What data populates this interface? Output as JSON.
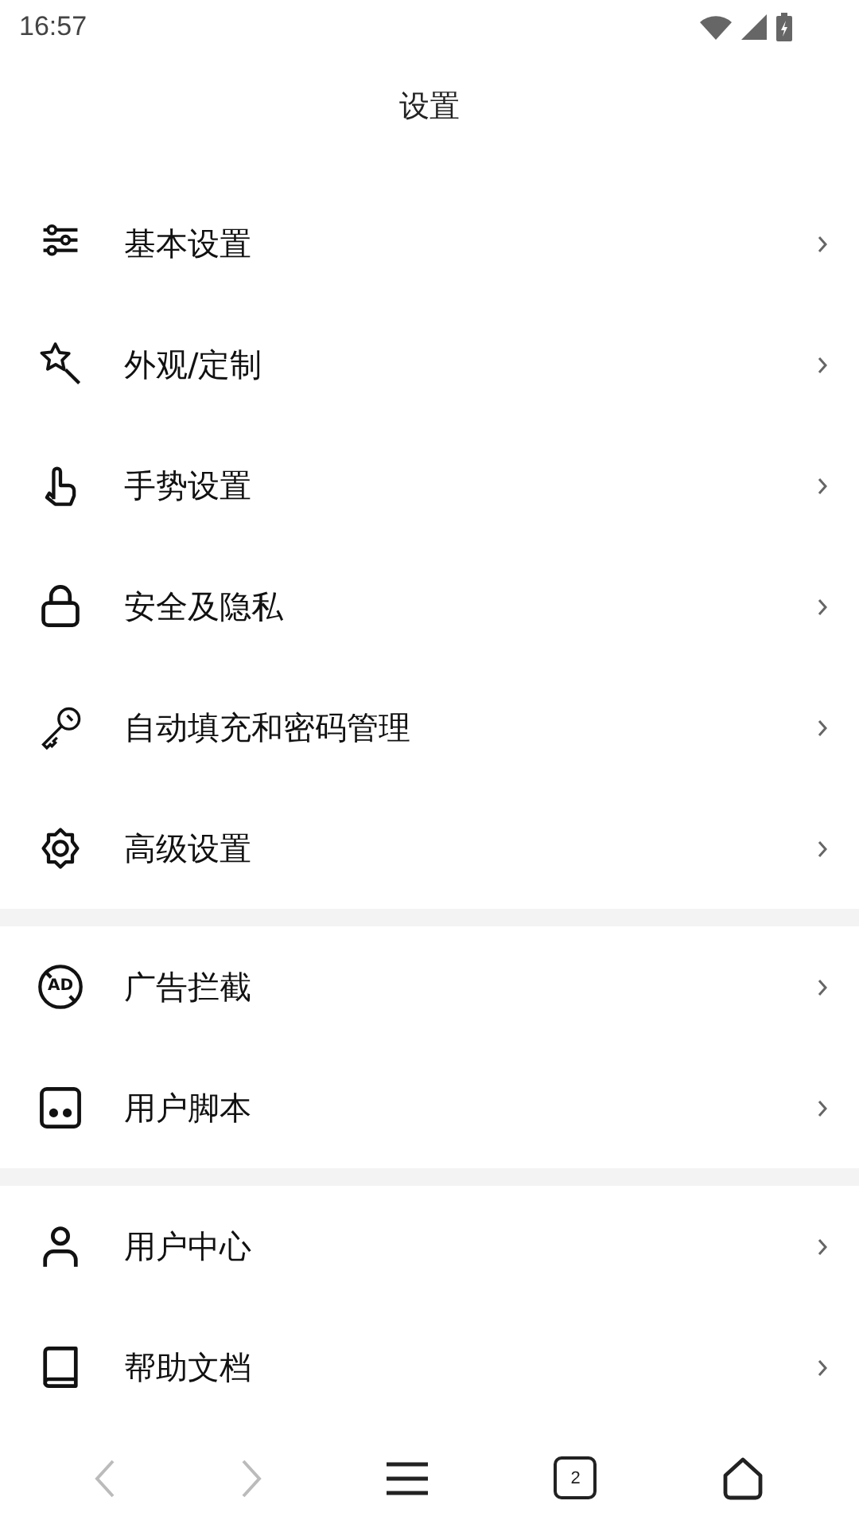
{
  "status_bar": {
    "time": "16:57"
  },
  "title": "设置",
  "groups": [
    {
      "items": [
        {
          "label": "基本设置"
        },
        {
          "label": "外观/定制"
        },
        {
          "label": "手势设置"
        },
        {
          "label": "安全及隐私"
        },
        {
          "label": "自动填充和密码管理"
        },
        {
          "label": "高级设置"
        }
      ]
    },
    {
      "items": [
        {
          "label": "广告拦截",
          "icon_text": "AD"
        },
        {
          "label": "用户脚本"
        }
      ]
    },
    {
      "items": [
        {
          "label": "用户中心"
        },
        {
          "label": "帮助文档"
        }
      ]
    }
  ],
  "bottom_nav": {
    "back_disabled": true,
    "forward_disabled": true,
    "tab_count": "2"
  }
}
